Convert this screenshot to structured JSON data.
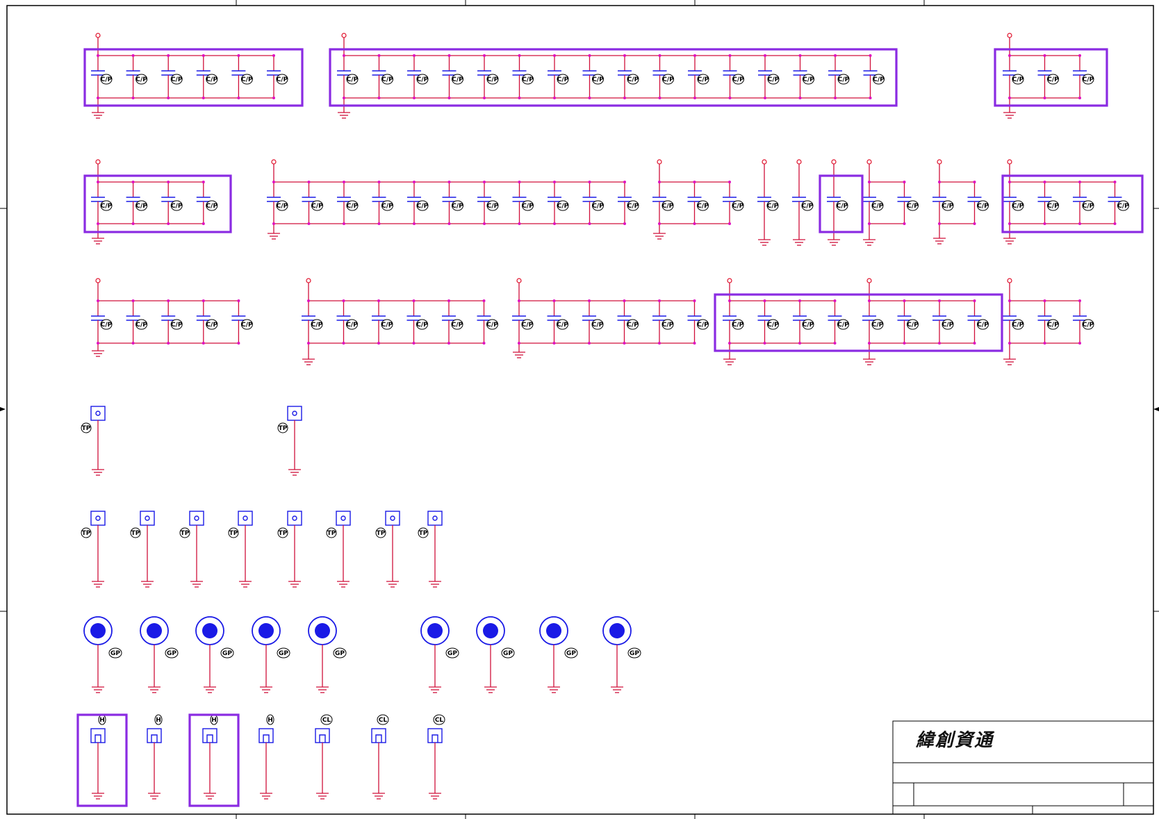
{
  "title_block": {
    "company": "緯創資通"
  },
  "labels": {
    "cap": "C/P",
    "test_point": "TP",
    "ground_pad": "GP",
    "hole": "H",
    "clip": "CL"
  },
  "colors": {
    "wire": "#d0103a",
    "component": "#1a1ae6",
    "junction": "#e010c0",
    "selection": "#8a2be2"
  }
}
